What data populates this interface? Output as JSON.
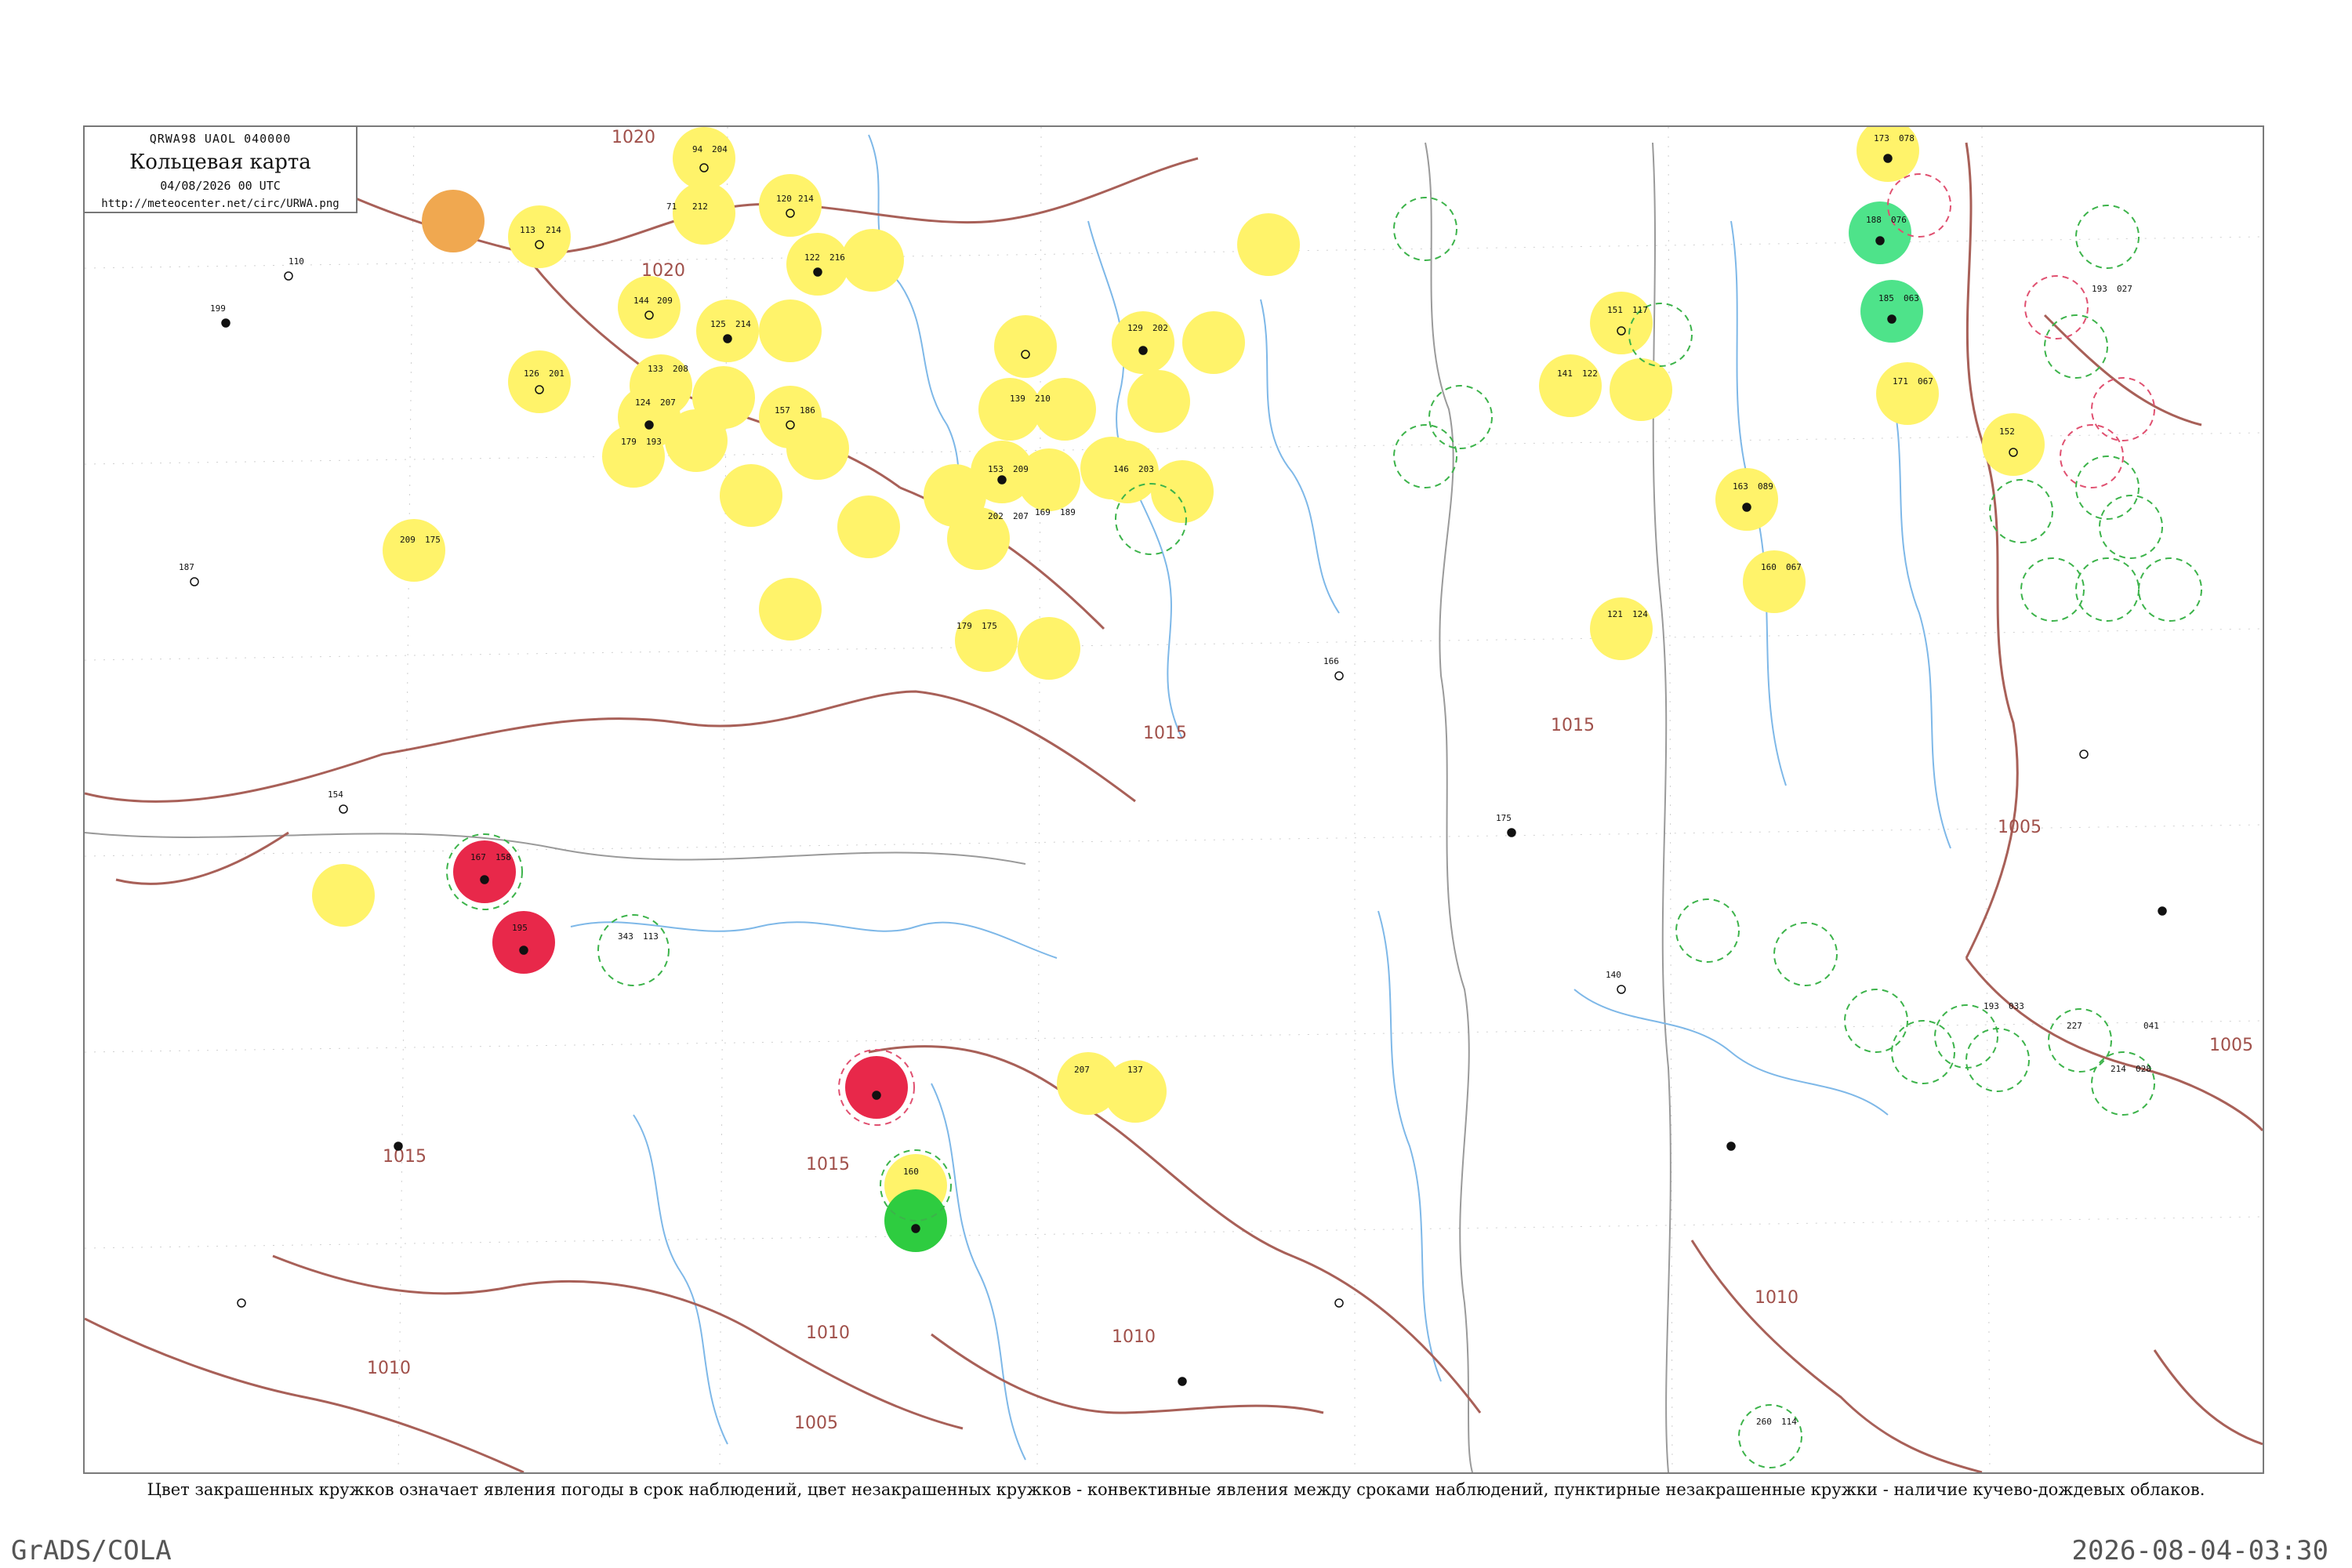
{
  "header": {
    "code": "QRWA98  UAOL  040000",
    "title": "Кольцевая карта",
    "date": "04/08/2026 00 UTC",
    "url": "http://meteocenter.net/circ/URWA.png"
  },
  "caption": "Цвет закрашенных кружков означает явления погоды в срок наблюдений, цвет незакрашенных кружков - конвективные явления между сроками наблюдений, пунктирные незакрашенные кружки - наличие кучево-дождевых облаков.",
  "footer": {
    "software": "GrADS/COLA",
    "timestamp": "2026-08-04-03:30"
  },
  "colors": {
    "isobar": "#a86058",
    "river": "#7eb8e8",
    "border": "#9a9a9a",
    "yellow_marker": "#fff36a",
    "orange_marker": "#f0a850",
    "red_marker": "#e8284a",
    "green_marker": "#2ecc40",
    "teal_marker": "#4ee38a",
    "dashed_cb": "#3cb34a",
    "dashed_red": "#e05070"
  },
  "isobars": [
    {
      "label": "1020"
    },
    {
      "label": "1020"
    },
    {
      "label": "1020"
    },
    {
      "label": "1015"
    },
    {
      "label": "1015"
    },
    {
      "label": "1015"
    },
    {
      "label": "1015"
    },
    {
      "label": "1010"
    },
    {
      "label": "1010"
    },
    {
      "label": "1010"
    },
    {
      "label": "1005"
    },
    {
      "label": "1005"
    },
    {
      "label": "1005"
    },
    {
      "label": "1010"
    }
  ],
  "stations": [
    {
      "value": "94"
    },
    {
      "value": "204"
    },
    {
      "value": "71"
    },
    {
      "value": "212"
    },
    {
      "value": "120"
    },
    {
      "value": "214"
    },
    {
      "value": "122"
    },
    {
      "value": "216"
    },
    {
      "value": "113"
    },
    {
      "value": "214"
    },
    {
      "value": "144"
    },
    {
      "value": "209"
    },
    {
      "value": "125"
    },
    {
      "value": "214"
    },
    {
      "value": "133"
    },
    {
      "value": "208"
    },
    {
      "value": "126"
    },
    {
      "value": "201"
    },
    {
      "value": "124"
    },
    {
      "value": "207"
    },
    {
      "value": "179"
    },
    {
      "value": "193"
    },
    {
      "value": "157"
    },
    {
      "value": "186"
    },
    {
      "value": "209"
    },
    {
      "value": "175"
    },
    {
      "value": "139"
    },
    {
      "value": "210"
    },
    {
      "value": "153"
    },
    {
      "value": "209"
    },
    {
      "value": "202"
    },
    {
      "value": "207"
    },
    {
      "value": "169"
    },
    {
      "value": "189"
    },
    {
      "value": "179"
    },
    {
      "value": "175"
    },
    {
      "value": "146"
    },
    {
      "value": "203"
    },
    {
      "value": "129"
    },
    {
      "value": "202"
    },
    {
      "value": "151"
    },
    {
      "value": "117"
    },
    {
      "value": "141"
    },
    {
      "value": "122"
    },
    {
      "value": "163"
    },
    {
      "value": "089"
    },
    {
      "value": "160"
    },
    {
      "value": "067"
    },
    {
      "value": "121"
    },
    {
      "value": "124"
    },
    {
      "value": "173"
    },
    {
      "value": "078"
    },
    {
      "value": "188"
    },
    {
      "value": "076"
    },
    {
      "value": "185"
    },
    {
      "value": "063"
    },
    {
      "value": "171"
    },
    {
      "value": "067"
    },
    {
      "value": "152"
    },
    {
      "value": "193"
    },
    {
      "value": "027"
    },
    {
      "value": "167"
    },
    {
      "value": "158"
    },
    {
      "value": "195"
    },
    {
      "value": "343"
    },
    {
      "value": "113"
    },
    {
      "value": "160"
    },
    {
      "value": "207"
    },
    {
      "value": "137"
    },
    {
      "value": "110"
    },
    {
      "value": "199"
    },
    {
      "value": "187"
    },
    {
      "value": "154"
    },
    {
      "value": "166"
    },
    {
      "value": "175"
    },
    {
      "value": "140"
    },
    {
      "value": "214"
    },
    {
      "value": "028"
    },
    {
      "value": "193"
    },
    {
      "value": "033"
    },
    {
      "value": "227"
    },
    {
      "value": "041"
    },
    {
      "value": "260"
    },
    {
      "value": "114"
    }
  ]
}
